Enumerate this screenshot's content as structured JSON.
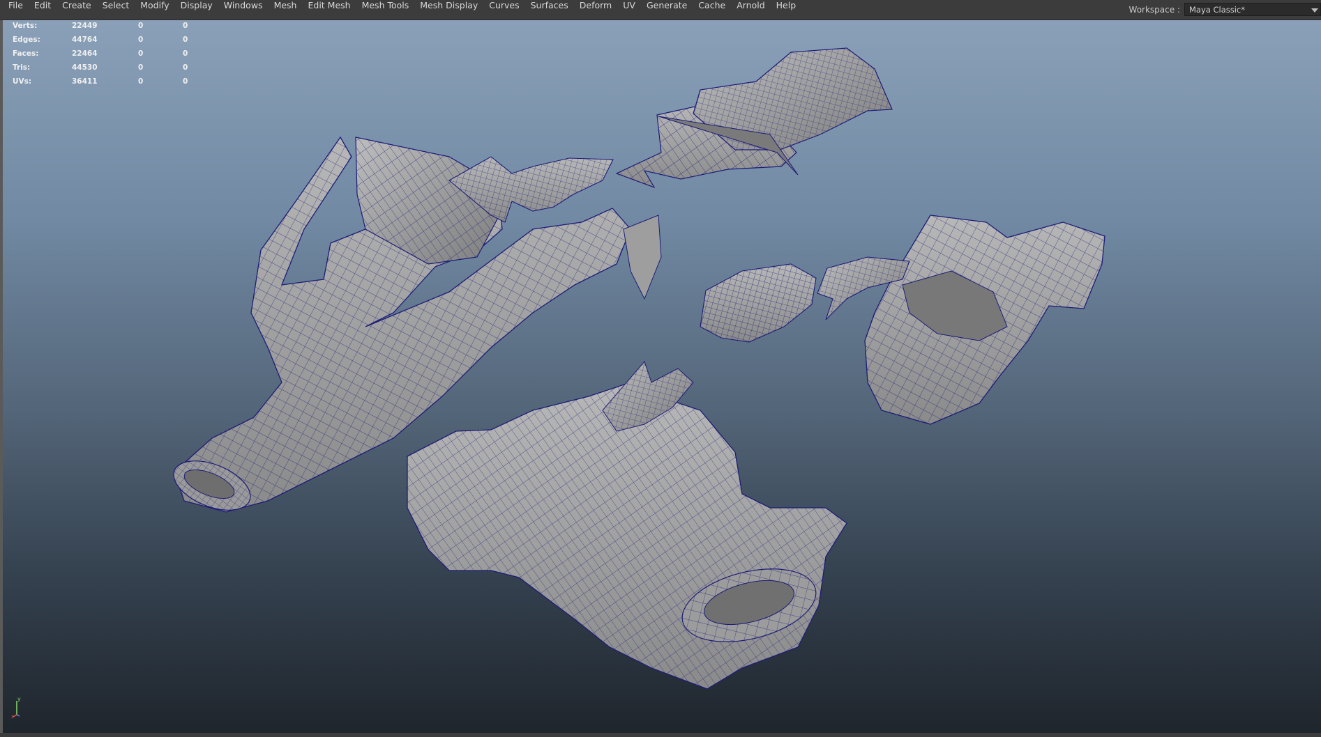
{
  "menubar": {
    "items": [
      "File",
      "Edit",
      "Create",
      "Select",
      "Modify",
      "Display",
      "Windows",
      "Mesh",
      "Edit Mesh",
      "Mesh Tools",
      "Mesh Display",
      "Curves",
      "Surfaces",
      "Deform",
      "UV",
      "Generate",
      "Cache",
      "Arnold",
      "Help"
    ]
  },
  "workspace": {
    "label": "Workspace :",
    "value": "Maya Classic*"
  },
  "hud": {
    "rows": [
      {
        "label": "Verts:",
        "v1": "22449",
        "v2": "0",
        "v3": "0"
      },
      {
        "label": "Edges:",
        "v1": "44764",
        "v2": "0",
        "v3": "0"
      },
      {
        "label": "Faces:",
        "v1": "22464",
        "v2": "0",
        "v3": "0"
      },
      {
        "label": "Tris:",
        "v1": "44530",
        "v2": "0",
        "v3": "0"
      },
      {
        "label": "UVs:",
        "v1": "36411",
        "v2": "0",
        "v3": "0"
      }
    ]
  },
  "axis": {
    "y_label": "y",
    "x_label": "x"
  },
  "colors": {
    "mesh_fill": "#a8a8a8",
    "mesh_shadow": "#6c6c6c",
    "wire": "#1c1c78",
    "viewport_top": "#8aa0b8",
    "viewport_bottom": "#1f252c"
  },
  "icons": [
    "dropdown-arrow-icon",
    "axis-gizmo-icon"
  ]
}
